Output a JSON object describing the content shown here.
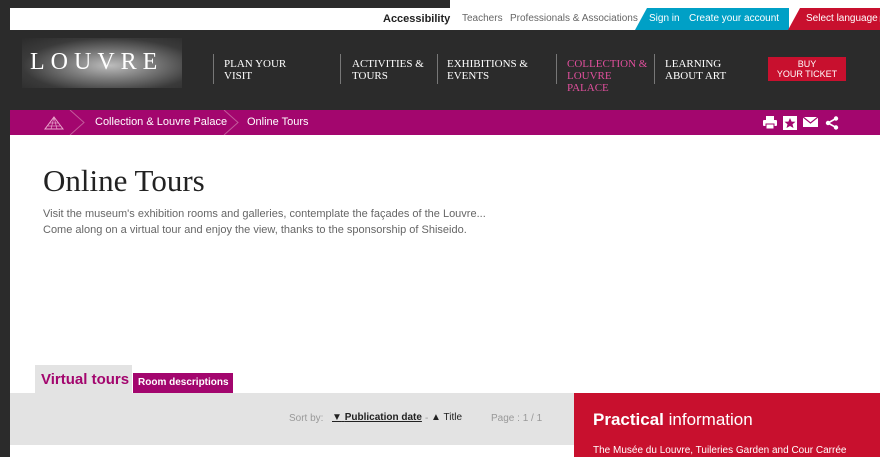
{
  "utility": {
    "accessibility": "Accessibility",
    "teachers": "Teachers",
    "professionals": "Professionals & Associations",
    "sign_in": "Sign in",
    "create_account": "Create your account",
    "select_language": "Select language"
  },
  "logo": {
    "text": "LOUVRE"
  },
  "nav": {
    "plan": "PLAN YOUR VISIT",
    "activities": [
      "ACTIVITIES &",
      "TOURS"
    ],
    "exhibitions": [
      "EXHIBITIONS &",
      "EVENTS"
    ],
    "collection": [
      "COLLECTION &",
      "LOUVRE",
      "PALACE"
    ],
    "learning": [
      "LEARNING",
      "ABOUT ART"
    ],
    "buy": [
      "BUY",
      "YOUR TICKET"
    ]
  },
  "breadcrumb": {
    "items": [
      "Collection & Louvre Palace",
      "Online Tours"
    ]
  },
  "tools": [
    "print-icon",
    "bookmark-icon",
    "mail-icon",
    "share-icon"
  ],
  "page": {
    "title": "Online Tours",
    "intro_1": "Visit the museum's exhibition rooms and galleries, contemplate the façades of the Louvre...",
    "intro_2": "Come along on a virtual tour and enjoy the view, thanks to the sponsorship of Shiseido."
  },
  "tabs": {
    "virtual": "Virtual tours",
    "rooms": "Room descriptions"
  },
  "sort": {
    "label": "Sort by:",
    "publication": "Publication date",
    "title": "Title",
    "page": "Page : 1 / 1"
  },
  "practical": {
    "title_bold": "Practical",
    "title_rest": " information",
    "text": "The Musée du Louvre, Tuileries Garden and Cour Carrée"
  },
  "colors": {
    "brand": "#a3066e",
    "accent": "#c8102e",
    "link": "#00a0c6"
  }
}
